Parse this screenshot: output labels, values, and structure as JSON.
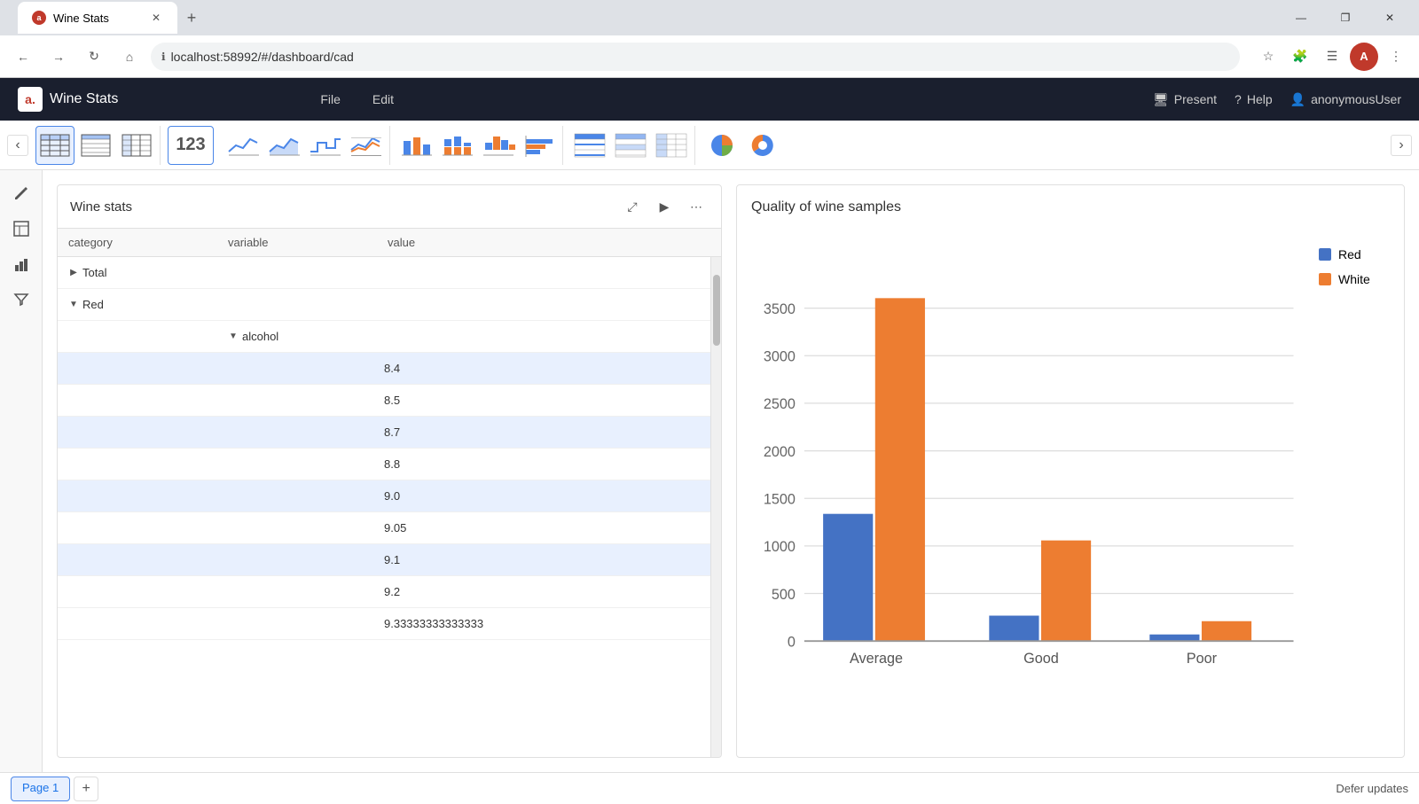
{
  "browser": {
    "tab_title": "Wine Stats",
    "tab_favicon": "a",
    "url": "localhost:58992/#/dashboard/cad",
    "new_tab_label": "+",
    "window_controls": [
      "—",
      "❐",
      "✕"
    ]
  },
  "app": {
    "logo_text": "a.",
    "title": "Wine Stats",
    "menu": [
      "File",
      "Edit"
    ],
    "header_actions": [
      "Present",
      "Help",
      "anonymousUser"
    ]
  },
  "toolbar": {
    "nav_left": "‹",
    "nav_right": "›",
    "number_label": "123",
    "sections": [
      "table",
      "line-charts",
      "bar-charts",
      "table-alt",
      "pie-charts"
    ]
  },
  "table_widget": {
    "title": "Wine stats",
    "columns": [
      "category",
      "variable",
      "value"
    ],
    "rows": [
      {
        "indent": 0,
        "toggle": "▶",
        "label": "Total",
        "variable": "",
        "value": "",
        "highlighted": false
      },
      {
        "indent": 0,
        "toggle": "▼",
        "label": "Red",
        "variable": "",
        "value": "",
        "highlighted": false
      },
      {
        "indent": 1,
        "toggle": "▼",
        "label": "",
        "variable": "alcohol",
        "value": "",
        "highlighted": false
      },
      {
        "indent": 2,
        "toggle": "",
        "label": "",
        "variable": "",
        "value": "8.4",
        "highlighted": true
      },
      {
        "indent": 2,
        "toggle": "",
        "label": "",
        "variable": "",
        "value": "8.5",
        "highlighted": false
      },
      {
        "indent": 2,
        "toggle": "",
        "label": "",
        "variable": "",
        "value": "8.7",
        "highlighted": true
      },
      {
        "indent": 2,
        "toggle": "",
        "label": "",
        "variable": "",
        "value": "8.8",
        "highlighted": false
      },
      {
        "indent": 2,
        "toggle": "",
        "label": "",
        "variable": "",
        "value": "9.0",
        "highlighted": true
      },
      {
        "indent": 2,
        "toggle": "",
        "label": "",
        "variable": "",
        "value": "9.05",
        "highlighted": false
      },
      {
        "indent": 2,
        "toggle": "",
        "label": "",
        "variable": "",
        "value": "9.1",
        "highlighted": true
      },
      {
        "indent": 2,
        "toggle": "",
        "label": "",
        "variable": "",
        "value": "9.2",
        "highlighted": false
      },
      {
        "indent": 2,
        "toggle": "",
        "label": "",
        "variable": "",
        "value": "9.33333333333333",
        "highlighted": false
      }
    ],
    "scroll_position": 20
  },
  "chart_widget": {
    "title": "Quality of wine samples",
    "legend": [
      {
        "label": "Red",
        "color": "#4472c4"
      },
      {
        "label": "White",
        "color": "#ed7d31"
      }
    ],
    "categories": [
      "Average",
      "Good",
      "Poor"
    ],
    "series": {
      "Red": [
        1350,
        270,
        70
      ],
      "White": [
        3650,
        1070,
        210
      ]
    },
    "y_axis": [
      0,
      500,
      1000,
      1500,
      2000,
      2500,
      3000,
      3500
    ],
    "colors": {
      "red": "#4472c4",
      "white": "#ed7d31"
    }
  },
  "bottom_bar": {
    "pages": [
      "Page 1"
    ],
    "active_page": "Page 1",
    "add_page_label": "+",
    "defer_updates": "Defer updates"
  },
  "sidebar": {
    "icons": [
      "pencil",
      "table",
      "chart",
      "filter"
    ]
  }
}
